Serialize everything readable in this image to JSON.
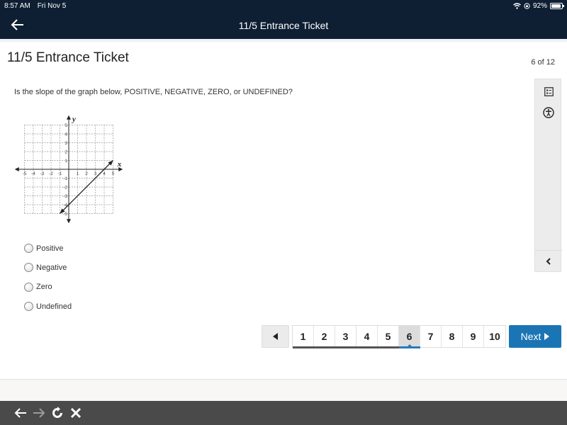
{
  "status_bar": {
    "time": "8:57 AM",
    "date": "Fri Nov 5",
    "battery": "92%",
    "battery_level": 0.92
  },
  "nav": {
    "title": "11/5 Entrance Ticket"
  },
  "page": {
    "title": "11/5 Entrance Ticket",
    "count": "6 of 12"
  },
  "question": {
    "text": "Is the slope of the graph below, POSITIVE, NEGATIVE, ZERO, or UNDEFINED?",
    "options": [
      {
        "label": "Positive",
        "selected": false
      },
      {
        "label": "Negative",
        "selected": false
      },
      {
        "label": "Zero",
        "selected": false
      },
      {
        "label": "Undefined",
        "selected": false
      }
    ]
  },
  "graph": {
    "x_label": "x",
    "y_label": "y",
    "x_range": [
      -5,
      5
    ],
    "y_range": [
      -5,
      5
    ],
    "x_ticks": [
      "-5",
      "-4",
      "-3",
      "-2",
      "-1",
      "1",
      "2",
      "3",
      "4",
      "5"
    ],
    "y_ticks": [
      "5",
      "4",
      "3",
      "2",
      "1",
      "-1",
      "-2",
      "-3",
      "-4",
      "-5"
    ],
    "line": {
      "from": [
        -1,
        -5
      ],
      "to": [
        5,
        1
      ]
    },
    "grid": "dashed"
  },
  "side_panel": {
    "icons": [
      "answer-list-icon",
      "accessibility-icon"
    ],
    "collapse_icon": "chevron-left-icon"
  },
  "pager": {
    "prev_icon": "triangle-left-icon",
    "pages": [
      "1",
      "2",
      "3",
      "4",
      "5",
      "6",
      "7",
      "8",
      "9",
      "10"
    ],
    "current": "6",
    "next_label": "Next",
    "colors": {
      "next_bg": "#1b75b4",
      "current_bg": "#dcdcdc",
      "nav_bg": "#0f1f33"
    }
  },
  "browser_bar": {
    "buttons": [
      "back-icon",
      "forward-icon",
      "reload-icon",
      "close-icon"
    ]
  }
}
